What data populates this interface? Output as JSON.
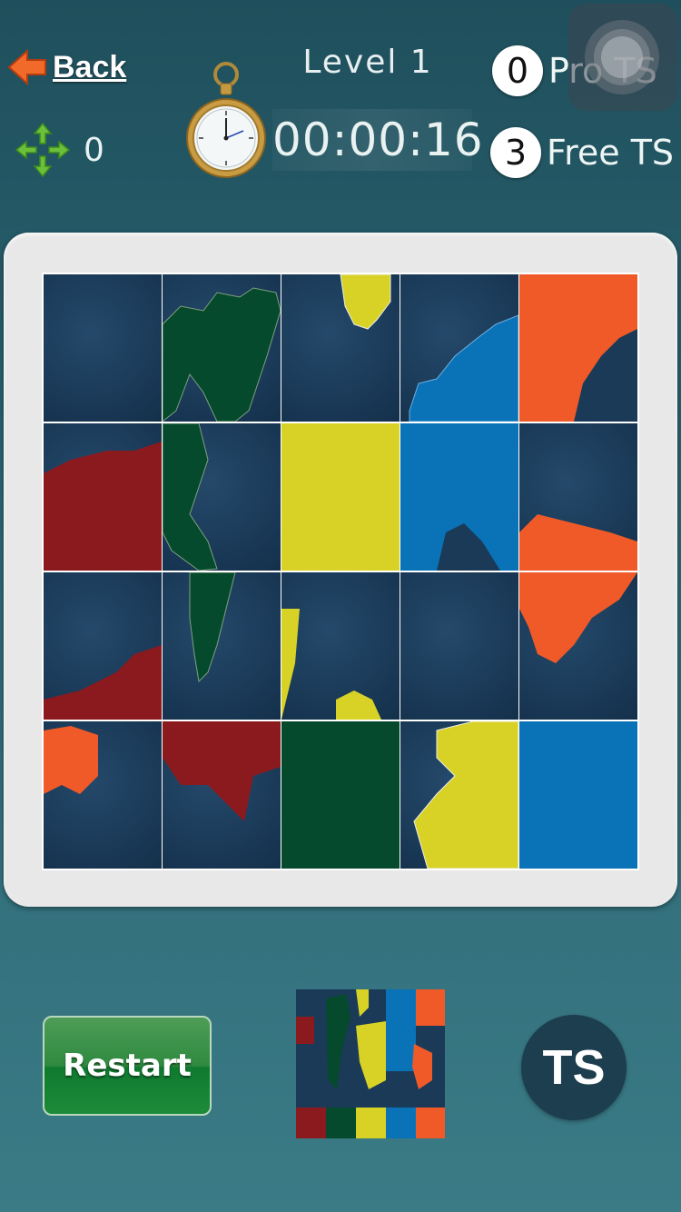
{
  "header": {
    "back_label": "Back",
    "level_label": "Level 1",
    "timer": "00:00:16",
    "moves_count": "0",
    "pro_ts": {
      "count": "0",
      "label": "Pro TS"
    },
    "free_ts": {
      "count": "3",
      "label": "Free TS"
    }
  },
  "board": {
    "rows": 4,
    "cols": 5,
    "colors": {
      "ocean": "#1a3a58",
      "red": "#8b1a1e",
      "green": "#054a2c",
      "yellow": "#d8d226",
      "blue": "#0a73b8",
      "orange": "#f05a28"
    }
  },
  "footer": {
    "restart_label": "Restart",
    "ts_label": "TS"
  }
}
